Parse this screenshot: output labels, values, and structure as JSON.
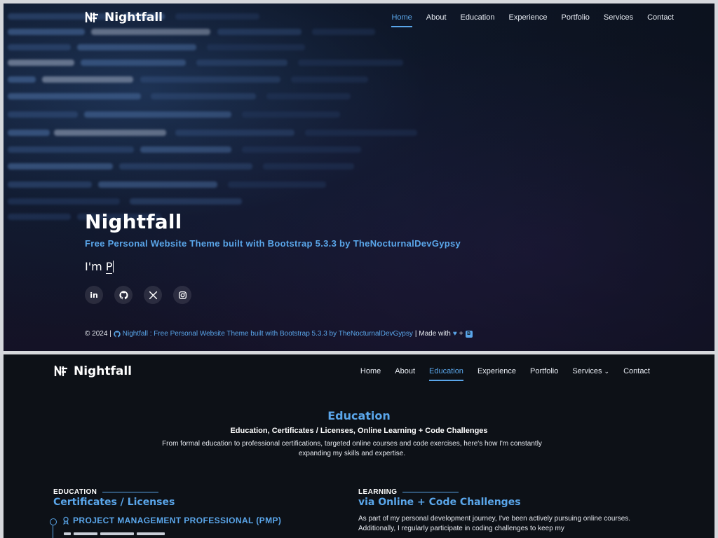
{
  "hero": {
    "brand": "Nightfall",
    "nav": [
      "Home",
      "About",
      "Education",
      "Experience",
      "Portfolio",
      "Services",
      "Contact"
    ],
    "active_nav": "Home",
    "title": "Nightfall",
    "subtitle": "Free Personal Website Theme built with Bootstrap 5.3.3 by TheNocturnalDevGypsy",
    "typed_prefix": "I'm ",
    "typed_text": "P",
    "socials": [
      {
        "icon": "linkedin-icon",
        "label": "in"
      },
      {
        "icon": "github-icon",
        "label": ""
      },
      {
        "icon": "x-icon",
        "label": ""
      },
      {
        "icon": "instagram-icon",
        "label": ""
      }
    ],
    "footer": {
      "copyright": "© 2024 |",
      "site_link": "Nightfall : Free Personal Website Theme built with Bootstrap 5.3.3 by TheNocturnalDevGypsy",
      "made_with": "| Made with",
      "plus": "+"
    }
  },
  "page": {
    "brand": "Nightfall",
    "nav": [
      "Home",
      "About",
      "Education",
      "Experience",
      "Portfolio",
      "Services",
      "Contact"
    ],
    "active_nav": "Education",
    "education": {
      "title": "Education",
      "subtitle": "Education, Certificates / Licenses, Online Learning + Code Challenges",
      "description": "From formal education to professional certifications, targeted online courses and code exercises, here's how I'm constantly expanding my skills and expertise.",
      "left": {
        "eyebrow": "EDUCATION",
        "heading": "Certificates / Licenses",
        "item": "PROJECT MANAGEMENT PROFESSIONAL (PMP)"
      },
      "right": {
        "eyebrow": "LEARNING",
        "heading": "via Online + Code Challenges",
        "text": "As part of my personal development journey, I've been actively pursuing online courses. Additionally, I regularly participate in coding challenges to keep my"
      }
    }
  },
  "colors": {
    "accent": "#5aa6ea",
    "background": "#0d1117",
    "text": "#e6e9ef"
  }
}
